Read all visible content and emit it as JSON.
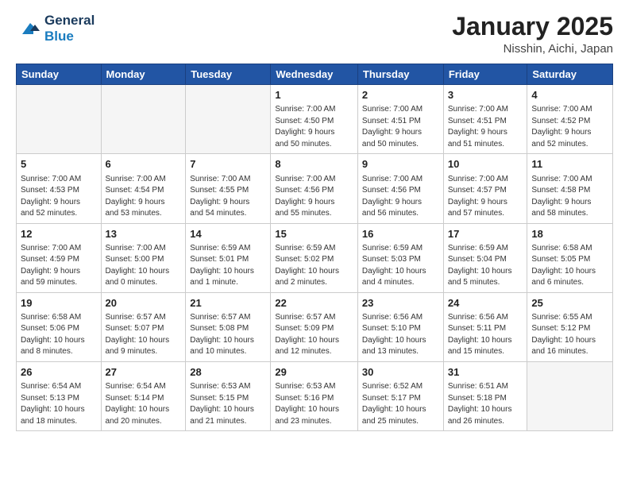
{
  "header": {
    "logo_general": "General",
    "logo_blue": "Blue",
    "month": "January 2025",
    "location": "Nisshin, Aichi, Japan"
  },
  "weekdays": [
    "Sunday",
    "Monday",
    "Tuesday",
    "Wednesday",
    "Thursday",
    "Friday",
    "Saturday"
  ],
  "weeks": [
    [
      {
        "day": "",
        "info": ""
      },
      {
        "day": "",
        "info": ""
      },
      {
        "day": "",
        "info": ""
      },
      {
        "day": "1",
        "info": "Sunrise: 7:00 AM\nSunset: 4:50 PM\nDaylight: 9 hours\nand 50 minutes."
      },
      {
        "day": "2",
        "info": "Sunrise: 7:00 AM\nSunset: 4:51 PM\nDaylight: 9 hours\nand 50 minutes."
      },
      {
        "day": "3",
        "info": "Sunrise: 7:00 AM\nSunset: 4:51 PM\nDaylight: 9 hours\nand 51 minutes."
      },
      {
        "day": "4",
        "info": "Sunrise: 7:00 AM\nSunset: 4:52 PM\nDaylight: 9 hours\nand 52 minutes."
      }
    ],
    [
      {
        "day": "5",
        "info": "Sunrise: 7:00 AM\nSunset: 4:53 PM\nDaylight: 9 hours\nand 52 minutes."
      },
      {
        "day": "6",
        "info": "Sunrise: 7:00 AM\nSunset: 4:54 PM\nDaylight: 9 hours\nand 53 minutes."
      },
      {
        "day": "7",
        "info": "Sunrise: 7:00 AM\nSunset: 4:55 PM\nDaylight: 9 hours\nand 54 minutes."
      },
      {
        "day": "8",
        "info": "Sunrise: 7:00 AM\nSunset: 4:56 PM\nDaylight: 9 hours\nand 55 minutes."
      },
      {
        "day": "9",
        "info": "Sunrise: 7:00 AM\nSunset: 4:56 PM\nDaylight: 9 hours\nand 56 minutes."
      },
      {
        "day": "10",
        "info": "Sunrise: 7:00 AM\nSunset: 4:57 PM\nDaylight: 9 hours\nand 57 minutes."
      },
      {
        "day": "11",
        "info": "Sunrise: 7:00 AM\nSunset: 4:58 PM\nDaylight: 9 hours\nand 58 minutes."
      }
    ],
    [
      {
        "day": "12",
        "info": "Sunrise: 7:00 AM\nSunset: 4:59 PM\nDaylight: 9 hours\nand 59 minutes."
      },
      {
        "day": "13",
        "info": "Sunrise: 7:00 AM\nSunset: 5:00 PM\nDaylight: 10 hours\nand 0 minutes."
      },
      {
        "day": "14",
        "info": "Sunrise: 6:59 AM\nSunset: 5:01 PM\nDaylight: 10 hours\nand 1 minute."
      },
      {
        "day": "15",
        "info": "Sunrise: 6:59 AM\nSunset: 5:02 PM\nDaylight: 10 hours\nand 2 minutes."
      },
      {
        "day": "16",
        "info": "Sunrise: 6:59 AM\nSunset: 5:03 PM\nDaylight: 10 hours\nand 4 minutes."
      },
      {
        "day": "17",
        "info": "Sunrise: 6:59 AM\nSunset: 5:04 PM\nDaylight: 10 hours\nand 5 minutes."
      },
      {
        "day": "18",
        "info": "Sunrise: 6:58 AM\nSunset: 5:05 PM\nDaylight: 10 hours\nand 6 minutes."
      }
    ],
    [
      {
        "day": "19",
        "info": "Sunrise: 6:58 AM\nSunset: 5:06 PM\nDaylight: 10 hours\nand 8 minutes."
      },
      {
        "day": "20",
        "info": "Sunrise: 6:57 AM\nSunset: 5:07 PM\nDaylight: 10 hours\nand 9 minutes."
      },
      {
        "day": "21",
        "info": "Sunrise: 6:57 AM\nSunset: 5:08 PM\nDaylight: 10 hours\nand 10 minutes."
      },
      {
        "day": "22",
        "info": "Sunrise: 6:57 AM\nSunset: 5:09 PM\nDaylight: 10 hours\nand 12 minutes."
      },
      {
        "day": "23",
        "info": "Sunrise: 6:56 AM\nSunset: 5:10 PM\nDaylight: 10 hours\nand 13 minutes."
      },
      {
        "day": "24",
        "info": "Sunrise: 6:56 AM\nSunset: 5:11 PM\nDaylight: 10 hours\nand 15 minutes."
      },
      {
        "day": "25",
        "info": "Sunrise: 6:55 AM\nSunset: 5:12 PM\nDaylight: 10 hours\nand 16 minutes."
      }
    ],
    [
      {
        "day": "26",
        "info": "Sunrise: 6:54 AM\nSunset: 5:13 PM\nDaylight: 10 hours\nand 18 minutes."
      },
      {
        "day": "27",
        "info": "Sunrise: 6:54 AM\nSunset: 5:14 PM\nDaylight: 10 hours\nand 20 minutes."
      },
      {
        "day": "28",
        "info": "Sunrise: 6:53 AM\nSunset: 5:15 PM\nDaylight: 10 hours\nand 21 minutes."
      },
      {
        "day": "29",
        "info": "Sunrise: 6:53 AM\nSunset: 5:16 PM\nDaylight: 10 hours\nand 23 minutes."
      },
      {
        "day": "30",
        "info": "Sunrise: 6:52 AM\nSunset: 5:17 PM\nDaylight: 10 hours\nand 25 minutes."
      },
      {
        "day": "31",
        "info": "Sunrise: 6:51 AM\nSunset: 5:18 PM\nDaylight: 10 hours\nand 26 minutes."
      },
      {
        "day": "",
        "info": ""
      }
    ]
  ]
}
